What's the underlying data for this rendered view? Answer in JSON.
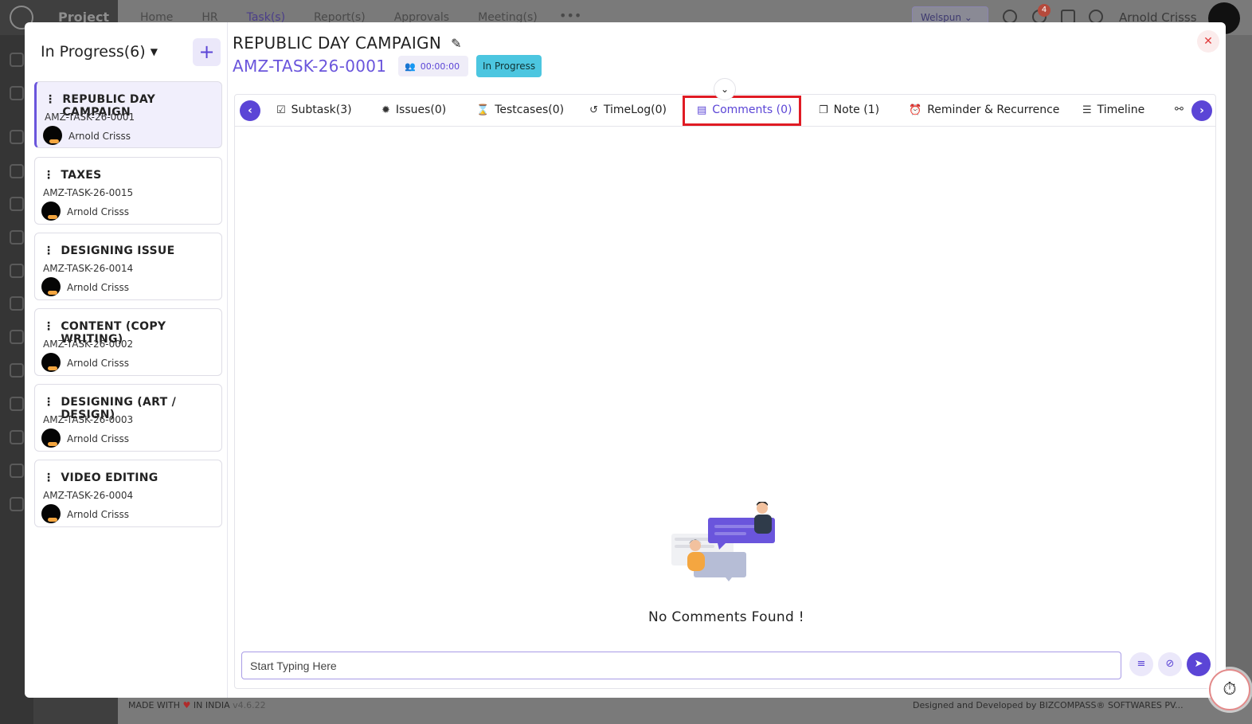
{
  "background": {
    "app_title": "Project",
    "nav": [
      "Home",
      "HR",
      "Task(s)",
      "Report(s)",
      "Approvals",
      "Meeting(s)"
    ],
    "more": "•••",
    "company": "Welspun",
    "notification_count": "4",
    "user": "Arnold Crisss",
    "footer_made": "MADE WITH",
    "footer_in_india": "IN INDIA",
    "footer_version": "v4.6.22",
    "footer_designed": "Designed and Developed by BIZCOMPASS® SOFTWARES PV..."
  },
  "left_panel": {
    "status_label": "In Progress(6)",
    "tasks": [
      {
        "title": "REPUBLIC DAY CAMPAIGN",
        "code": "AMZ-TASK-26-0001",
        "assignee": "Arnold Crisss"
      },
      {
        "title": "TAXES",
        "code": "AMZ-TASK-26-0015",
        "assignee": "Arnold Crisss"
      },
      {
        "title": "DESIGNING ISSUE",
        "code": "AMZ-TASK-26-0014",
        "assignee": "Arnold Crisss"
      },
      {
        "title": "CONTENT (COPY WRITING)",
        "code": "AMZ-TASK-26-0002",
        "assignee": "Arnold Crisss"
      },
      {
        "title": "DESIGNING (ART / DESIGN)",
        "code": "AMZ-TASK-26-0003",
        "assignee": "Arnold Crisss"
      },
      {
        "title": "VIDEO EDITING",
        "code": "AMZ-TASK-26-0004",
        "assignee": "Arnold Crisss"
      }
    ]
  },
  "task": {
    "title": "REPUBLIC DAY CAMPAIGN",
    "code": "AMZ-TASK-26-0001",
    "timer": "00:00:00",
    "status": "In Progress"
  },
  "tabs": [
    {
      "label": "Subtask(3)",
      "icon": "check-circle-icon"
    },
    {
      "label": "Issues(0)",
      "icon": "bug-icon"
    },
    {
      "label": "Testcases(0)",
      "icon": "hourglass-icon"
    },
    {
      "label": "TimeLog(0)",
      "icon": "history-icon"
    },
    {
      "label": "Comments (0)",
      "icon": "comment-icon"
    },
    {
      "label": "Note (1)",
      "icon": "note-icon"
    },
    {
      "label": "Reminder & Recurrence",
      "icon": "alarm-icon"
    },
    {
      "label": "Timeline",
      "icon": "timeline-icon"
    }
  ],
  "comments": {
    "empty_text": "No Comments Found !",
    "placeholder": "Start Typing Here"
  },
  "colors": {
    "accent": "#5b45d6",
    "status_chip": "#4cc6e0",
    "highlight": "#e01b24",
    "close": "#e03b3b"
  }
}
